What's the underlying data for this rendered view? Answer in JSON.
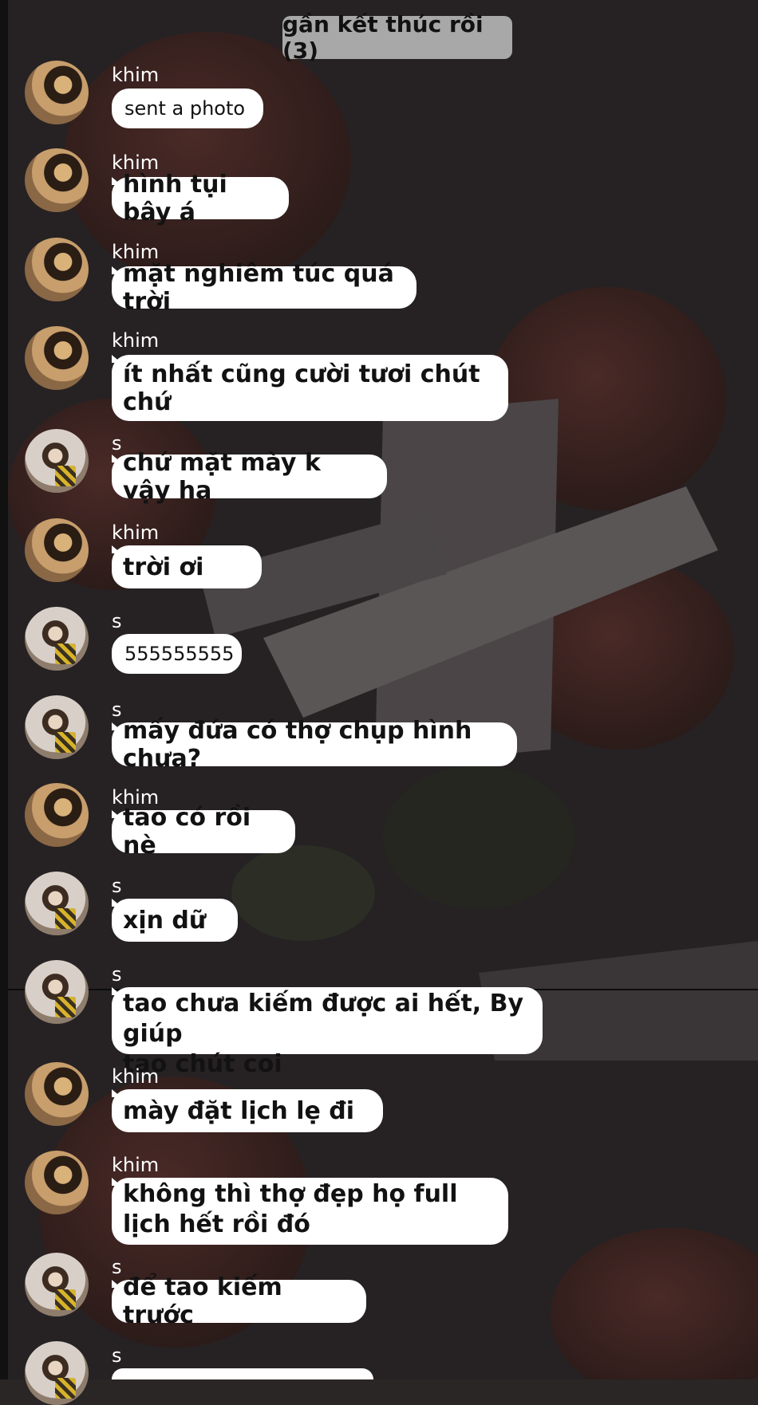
{
  "chat": {
    "title": "gần kết thúc rồi (3)",
    "messages": [
      {
        "sender": "khim",
        "text": "sent a photo",
        "style": "plain"
      },
      {
        "sender": "khim",
        "text": "hình tụi bây á",
        "style": "bold"
      },
      {
        "sender": "khim",
        "text": "mặt nghiêm túc quá trời",
        "style": "bold"
      },
      {
        "sender": "khim",
        "text": "ít nhất cũng cười tươi chút chứ",
        "style": "bold"
      },
      {
        "sender": "s",
        "text": "chứ mặt mày k vậy ha",
        "style": "bold"
      },
      {
        "sender": "khim",
        "text": "trời ơi",
        "style": "bold"
      },
      {
        "sender": "s",
        "text": "555555555",
        "style": "plain"
      },
      {
        "sender": "s",
        "text": "mấy đứa có thợ chụp hình chưa?",
        "style": "bold"
      },
      {
        "sender": "khim",
        "text": "tao có rồi nè",
        "style": "bold"
      },
      {
        "sender": "s",
        "text": "xịn dữ",
        "style": "bold"
      },
      {
        "sender": "s",
        "text": "tao chưa kiếm được ai hết, By giúp",
        "text2": "tao chút coi",
        "style": "bold"
      },
      {
        "sender": "khim",
        "text": "mày đặt lịch lẹ đi",
        "style": "bold"
      },
      {
        "sender": "khim",
        "text": "không thì thợ đẹp họ full",
        "text2": "lịch hết rồi đó",
        "style": "bold"
      },
      {
        "sender": "s",
        "text": "để tao kiếm trước",
        "style": "bold"
      },
      {
        "sender": "s",
        "text": "",
        "style": "bold"
      }
    ]
  },
  "avatars": {
    "khim": "girl-portrait-avatar",
    "s": "boy-portrait-avatar"
  },
  "colors": {
    "bubble": "#ffffff",
    "title_bg": "#a8a8a8",
    "background": "#2a2626",
    "text_on_bg": "#ffffff"
  }
}
